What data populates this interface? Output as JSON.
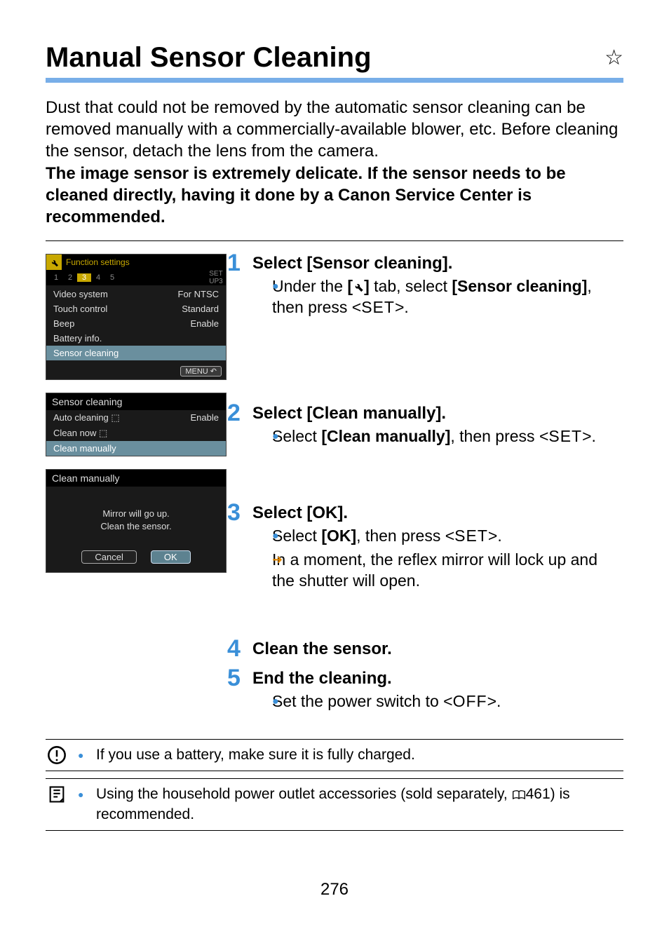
{
  "title": "Manual Sensor Cleaning",
  "star": "☆",
  "intro_plain": "Dust that could not be removed by the automatic sensor cleaning can be removed manually with a commercially-available blower, etc. Before cleaning the sensor, detach the lens from the camera.",
  "intro_bold": "The image sensor is extremely delicate. If the sensor needs to be cleaned directly, having it done by a Canon Service Center is recommended.",
  "screen1": {
    "header": "Function settings",
    "tabs": [
      "1",
      "2",
      "3",
      "4",
      "5"
    ],
    "selected_tab_index": 2,
    "setup_label": "SET UP3",
    "rows": [
      {
        "label": "Video system",
        "value": "For NTSC"
      },
      {
        "label": "Touch control",
        "value": "Standard"
      },
      {
        "label": "Beep",
        "value": "Enable"
      },
      {
        "label": "Battery info.",
        "value": ""
      },
      {
        "label": "Sensor cleaning",
        "value": "",
        "selected": true
      }
    ],
    "menu_btn": "MENU ↶"
  },
  "screen2": {
    "title": "Sensor cleaning",
    "rows": [
      {
        "label": "Auto cleaning ⬚",
        "value": "Enable"
      },
      {
        "label": "Clean now ⬚",
        "value": ""
      },
      {
        "label": "Clean manually",
        "value": "",
        "selected": true
      }
    ]
  },
  "screen3": {
    "title": "Clean manually",
    "msg_line1": "Mirror will go up.",
    "msg_line2": "Clean the sensor.",
    "cancel": "Cancel",
    "ok": "OK"
  },
  "steps": {
    "s1": {
      "num": "1",
      "title": "Select [Sensor cleaning].",
      "line_a": "Under the ",
      "line_b": " tab, select ",
      "sensor_bold": "[Sensor cleaning]",
      "line_c": ", then press <",
      "set": "SET",
      "line_d": ">."
    },
    "s2": {
      "num": "2",
      "title": "Select [Clean manually].",
      "line_a": "Select ",
      "clean_bold": "[Clean manually]",
      "line_b": ", then press <",
      "set": "SET",
      "line_c": ">."
    },
    "s3": {
      "num": "3",
      "title": "Select [OK].",
      "b1_a": "Select ",
      "b1_bold": "[OK]",
      "b1_b": ", then press <",
      "set": "SET",
      "b1_c": ">.",
      "b2": "In a moment, the reflex mirror will lock up and the shutter will open."
    },
    "s4": {
      "num": "4",
      "title": "Clean the sensor."
    },
    "s5": {
      "num": "5",
      "title": "End the cleaning.",
      "line_a": "Set the power switch to <",
      "off": "OFF",
      "line_b": ">."
    }
  },
  "note1": "If you use a battery, make sure it is fully charged.",
  "note2_a": "Using the household power outlet accessories (sold separately, ",
  "note2_ref": "461",
  "note2_b": ") is recommended.",
  "page_number": "276"
}
